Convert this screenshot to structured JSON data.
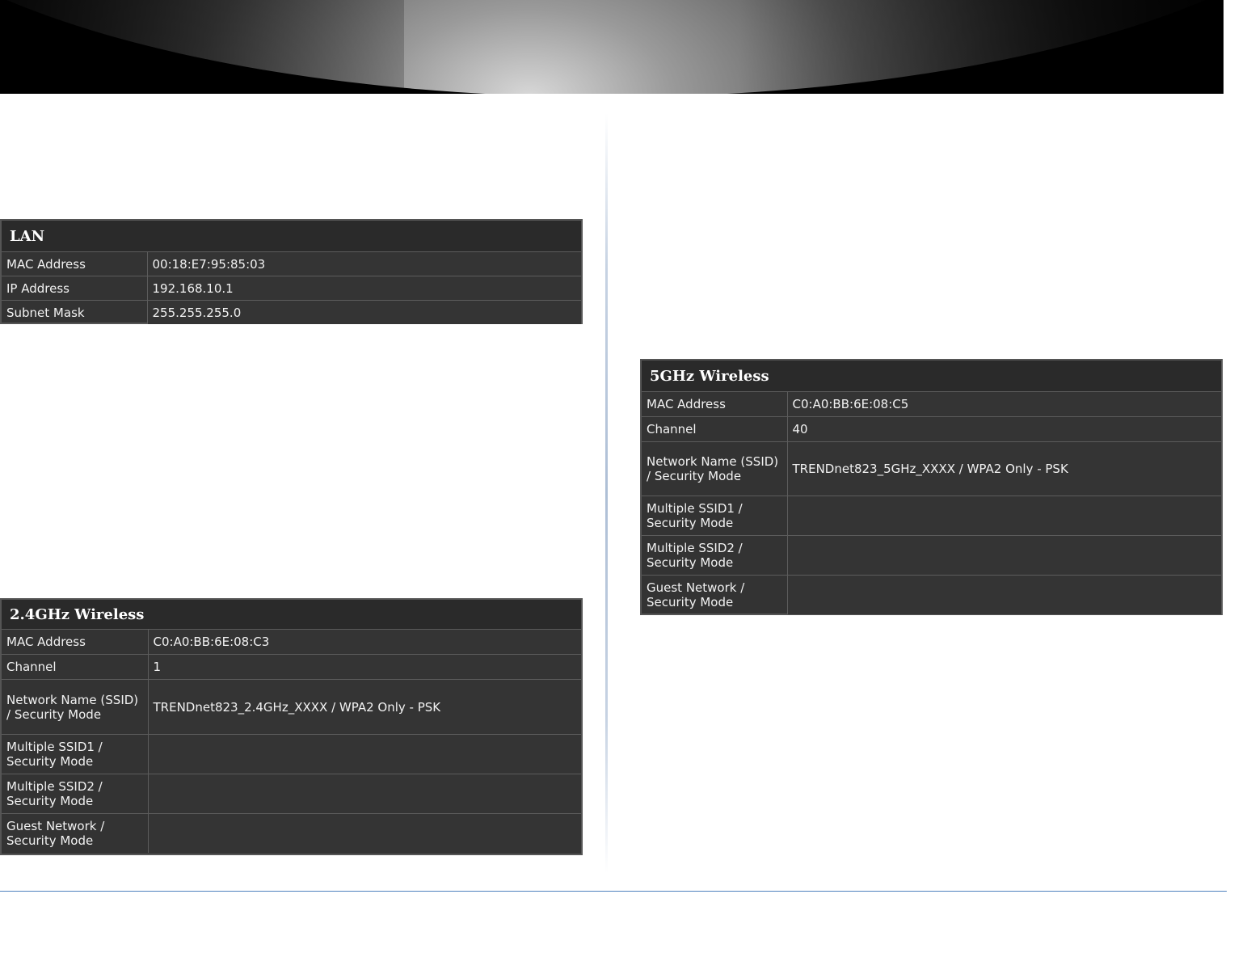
{
  "lan": {
    "title": "LAN",
    "rows": [
      {
        "label": "MAC Address",
        "value": "00:18:E7:95:85:03"
      },
      {
        "label": "IP Address",
        "value": "192.168.10.1"
      },
      {
        "label": "Subnet Mask",
        "value": "255.255.255.0"
      }
    ]
  },
  "wireless_24": {
    "title": "2.4GHz Wireless",
    "rows": [
      {
        "label": "MAC Address",
        "value": "C0:A0:BB:6E:08:C3"
      },
      {
        "label": "Channel",
        "value": "1"
      },
      {
        "label": "Network Name (SSID) / Security Mode",
        "value": "TRENDnet823_2.4GHz_XXXX / WPA2 Only - PSK"
      },
      {
        "label": "Multiple SSID1 / Security Mode",
        "value": ""
      },
      {
        "label": "Multiple SSID2 / Security Mode",
        "value": ""
      },
      {
        "label": "Guest Network / Security Mode",
        "value": ""
      }
    ]
  },
  "wireless_5": {
    "title": "5GHz Wireless",
    "rows": [
      {
        "label": "MAC Address",
        "value": "C0:A0:BB:6E:08:C5"
      },
      {
        "label": "Channel",
        "value": "40"
      },
      {
        "label": "Network Name (SSID) / Security Mode",
        "value": "TRENDnet823_5GHz_XXXX / WPA2 Only - PSK"
      },
      {
        "label": "Multiple SSID1 / Security Mode",
        "value": ""
      },
      {
        "label": "Multiple SSID2 / Security Mode",
        "value": ""
      },
      {
        "label": "Guest Network / Security Mode",
        "value": ""
      }
    ]
  }
}
